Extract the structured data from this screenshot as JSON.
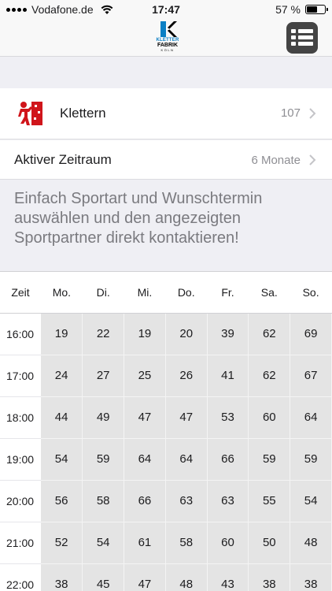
{
  "status": {
    "carrier": "Vodafone.de",
    "time": "17:47",
    "battery": "57 %",
    "battery_level": 0.57
  },
  "nav": {
    "logo": {
      "line1": "KLETTER",
      "line2": "FABRIK",
      "line3": "KÖLN"
    },
    "menu_icon": "list-icon"
  },
  "sport": {
    "label": "Klettern",
    "count": "107",
    "icon": "climbing-icon"
  },
  "period": {
    "label": "Aktiver Zeitraum",
    "value": "6 Monate"
  },
  "info": "Einfach Sportart und Wunschtermin auswählen und den angezeigten Sportpartner direkt kontaktieren!",
  "table": {
    "time_header": "Zeit",
    "days": [
      "Mo.",
      "Di.",
      "Mi.",
      "Do.",
      "Fr.",
      "Sa.",
      "So."
    ],
    "rows": [
      {
        "time": "16:00",
        "values": [
          "19",
          "22",
          "19",
          "20",
          "39",
          "62",
          "69"
        ]
      },
      {
        "time": "17:00",
        "values": [
          "24",
          "27",
          "25",
          "26",
          "41",
          "62",
          "67"
        ]
      },
      {
        "time": "18:00",
        "values": [
          "44",
          "49",
          "47",
          "47",
          "53",
          "60",
          "64"
        ]
      },
      {
        "time": "19:00",
        "values": [
          "54",
          "59",
          "64",
          "64",
          "66",
          "59",
          "59"
        ]
      },
      {
        "time": "20:00",
        "values": [
          "56",
          "58",
          "66",
          "63",
          "63",
          "55",
          "54"
        ]
      },
      {
        "time": "21:00",
        "values": [
          "52",
          "54",
          "61",
          "58",
          "60",
          "50",
          "48"
        ]
      },
      {
        "time": "22:00",
        "values": [
          "38",
          "45",
          "47",
          "48",
          "43",
          "38",
          "38"
        ]
      }
    ]
  },
  "colors": {
    "accent_red": "#d0151b",
    "logo_blue": "#0a7fc4",
    "cell_bg": "#e4e4e4"
  }
}
